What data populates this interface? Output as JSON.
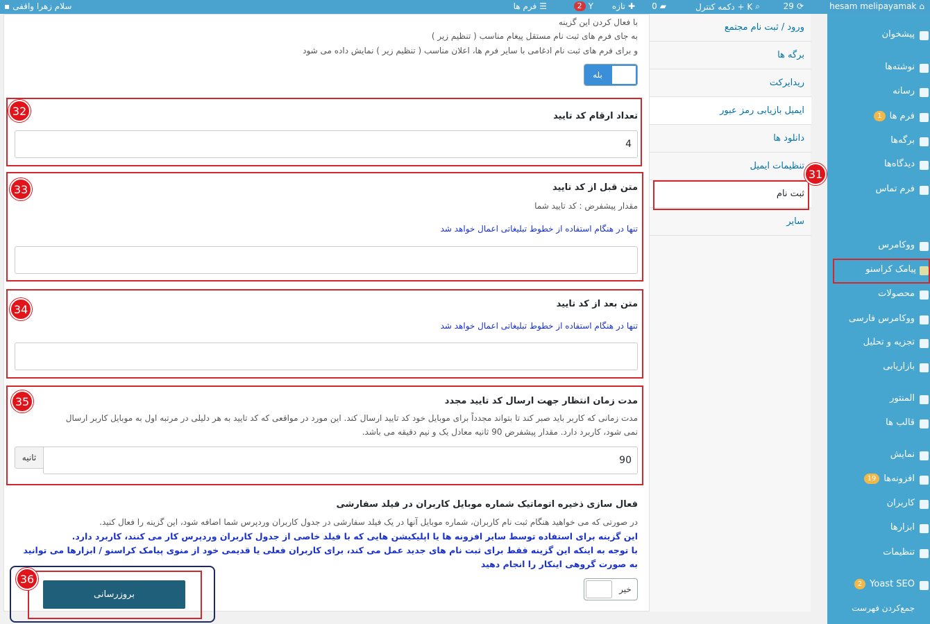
{
  "topbar": {
    "site_name": "hesam melipayamak",
    "updates_count": "29",
    "control_button": "دکمه کنترل + K",
    "comments_count": "0",
    "new_label": "تازه",
    "yoast_count": "2",
    "forms_label": "فرم ها",
    "greeting": "سلام زهرا واقفی"
  },
  "sidebar": {
    "items": [
      {
        "label": "پیشخوان"
      },
      {
        "label": "نوشته‌ها"
      },
      {
        "label": "رسانه"
      },
      {
        "label": "فرم ها",
        "badge": "1"
      },
      {
        "label": "برگه‌ها"
      },
      {
        "label": "دیدگاه‌ها"
      },
      {
        "label": "فرم تماس"
      },
      {
        "label": "ووکامرس"
      },
      {
        "label": "پیامک کراسنو"
      },
      {
        "label": "محصولات"
      },
      {
        "label": "ووکامرس فارسی"
      },
      {
        "label": "تجزیه و تحلیل"
      },
      {
        "label": "بازاریابی"
      },
      {
        "label": "المنتور"
      },
      {
        "label": "قالب ها"
      },
      {
        "label": "نمایش"
      },
      {
        "label": "افزونه‌ها",
        "badge": "19"
      },
      {
        "label": "کاربران"
      },
      {
        "label": "ابزارها"
      },
      {
        "label": "تنظیمات"
      },
      {
        "label": "Yoast SEO",
        "badge": "2"
      },
      {
        "label": "جمع‌کردن فهرست"
      }
    ]
  },
  "tabs": [
    {
      "label": "ورود / ثبت نام مجتمع"
    },
    {
      "label": "برگه ها"
    },
    {
      "label": "ریدایرکت"
    },
    {
      "label": "ایمیل بازیابی رمز عبور"
    },
    {
      "label": "دانلود ها"
    },
    {
      "label": "تنظیمات ایمیل"
    },
    {
      "label": "ثبت نام"
    },
    {
      "label": "سایر"
    }
  ],
  "intro": {
    "line1": "با فعال کردن این گزینه",
    "line2": "به جای فرم های ثبت نام مستقل پیغام مناسب ( تنظیم زیر )",
    "line3": "و برای فرم های ثبت نام ادغامی با سایر فرم ها، اعلان مناسب ( تنظیم زیر ) نمایش داده می شود",
    "toggle_on": "بله"
  },
  "code_digits": {
    "label": "تعداد ارقام کد تایید",
    "value": "4"
  },
  "before_code": {
    "label": "متن قبل از کد تایید",
    "default": "مقدار پیشفرض : کد تایید شما",
    "note": "تنها در هنگام استفاده از خطوط تبلیغاتی اعمال خواهد شد"
  },
  "after_code": {
    "label": "متن بعد از کد تایید",
    "note": "تنها در هنگام استفاده از خطوط تبلیغاتی اعمال خواهد شد"
  },
  "resend_wait": {
    "label": "مدت زمان انتظار جهت ارسال کد تایید مجدد",
    "desc1": "مدت زمانی که کاربر باید صبر کند تا بتواند مجدداً برای موبایل خود کد تایید ارسال کند. این مورد در مواقعی که کد تایید به هر دلیلی در مرتبه اول به موبایل کاربر ارسال",
    "desc2": "نمی شود، کاربرد دارد. مقدار پیشفرض 90 ثانیه معادل یک و نیم دقیقه می باشد.",
    "value": "90",
    "unit": "ثانیه"
  },
  "auto_save": {
    "label": "فعال سازی ذخیره اتوماتیک شماره موبایل کاربران در فیلد سفارشی",
    "desc": "در صورتی که می خواهید هنگام ثبت نام کاربران، شماره موبایل آنها در یک فیلد سفارشی در جدول کاربران وردپرس شما اضافه شود، این گزینه را فعال کنید.",
    "bold1": "این گزینه برای استفاده توسط سایر افزونه ها یا اپلیکیشن هایی که با فیلد خاصی از جدول کاربران وردپرس کار می کنند، کاربرد دارد.",
    "bold2": "با توجه به اینکه این گزینه فقط برای ثبت نام های جدید عمل می کند، برای کاربران فعلی یا قدیمی خود از منوی پیامک کراسنو / ابزارها می توانید",
    "bold3": "به صورت گروهی اینکار را انجام دهید",
    "toggle_off": "خیر"
  },
  "update_button": "بروزرسانی",
  "markers": {
    "m31": "31",
    "m32": "32",
    "m33": "33",
    "m34": "34",
    "m35": "35",
    "m36": "36"
  },
  "colors": {
    "admin_bar": "#4aa3cf",
    "sidebar": "#46a6cf",
    "highlight_red": "#d0282d",
    "button": "#1f5f7a",
    "link_blue": "#1b33c9"
  }
}
